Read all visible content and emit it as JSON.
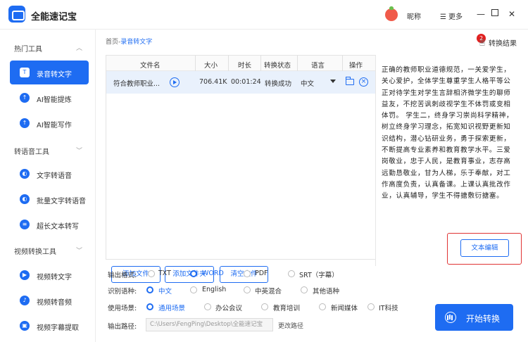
{
  "app": {
    "title": "全能速记宝",
    "username": "昵称",
    "more_label": "更多"
  },
  "sidebar": {
    "sections": [
      {
        "title": "热门工具",
        "items": [
          {
            "label": "录音转文字",
            "active": true
          },
          {
            "label": "AI智能提炼"
          },
          {
            "label": "AI智能写作"
          }
        ]
      },
      {
        "title": "转语音工具",
        "items": [
          {
            "label": "文字转语音"
          },
          {
            "label": "批量文字转语音"
          },
          {
            "label": "超长文本转写"
          }
        ]
      },
      {
        "title": "视频转换工具",
        "items": [
          {
            "label": "视频转文字"
          },
          {
            "label": "视频转音频"
          },
          {
            "label": "视频字幕提取"
          }
        ]
      }
    ]
  },
  "breadcrumb": {
    "home": "首页",
    "sep": "-",
    "current": "录音转文字"
  },
  "results": {
    "badge": "2",
    "label": "转换结果"
  },
  "table": {
    "headers": [
      "文件名",
      "大小",
      "时长",
      "转换状态",
      "语言",
      "操作"
    ],
    "rows": [
      {
        "name": "符合教师职业...",
        "size": "706.41K",
        "duration": "00:01:24",
        "status": "转换成功",
        "language": "中文"
      }
    ]
  },
  "buttons": {
    "add_file": "添加文件",
    "add_folder": "添加文件夹",
    "clear_files": "清空文件",
    "text_edit": "文本编辑",
    "start": "开始转换",
    "change_path": "更改路径"
  },
  "transcript": "正确的教师职业道德规范，一关爱学生，关心爱护，全体学生尊重学生人格平等公正对待学生对学生言辞相济微学生的聊师益友，不挖苦讽刺歧视学生不体罚或变相体罚。 学生二，终身学习崇尚科学精神，树立终身学习理念，拓宽知识视野更新知识结构，潜心钻研业务，勇于探索更新，不断提高专业素养和教育教学水平。三爱岗敬业，忠于人民，是教育事业，志存高远勤恳敬业，甘为人梯，乐于奉献，对工作高度负责，认真备课。上课认真批改作业，认真辅导，学生不得搪敷衍搪塞。",
  "options": {
    "format": {
      "label": "输出格式:",
      "choices": [
        "TXT",
        "WORD",
        "PDF",
        "SRT（字幕）"
      ],
      "selected": 1
    },
    "language": {
      "label": "识别语种:",
      "choices": [
        "中文",
        "English",
        "中英混合",
        "其他语种"
      ],
      "selected": 0
    },
    "scene": {
      "label": "使用场景:",
      "choices": [
        "通用场景",
        "办公会议",
        "教育培训",
        "新闻媒体",
        "IT科技"
      ],
      "selected": 0
    },
    "path": {
      "label": "输出路径:",
      "value": "C:\\Users\\FengPing\\Desktop\\全能速记宝"
    }
  },
  "colors": {
    "accent": "#1e6cf2",
    "highlight_border": "#e03434",
    "badge": "#e02020"
  }
}
